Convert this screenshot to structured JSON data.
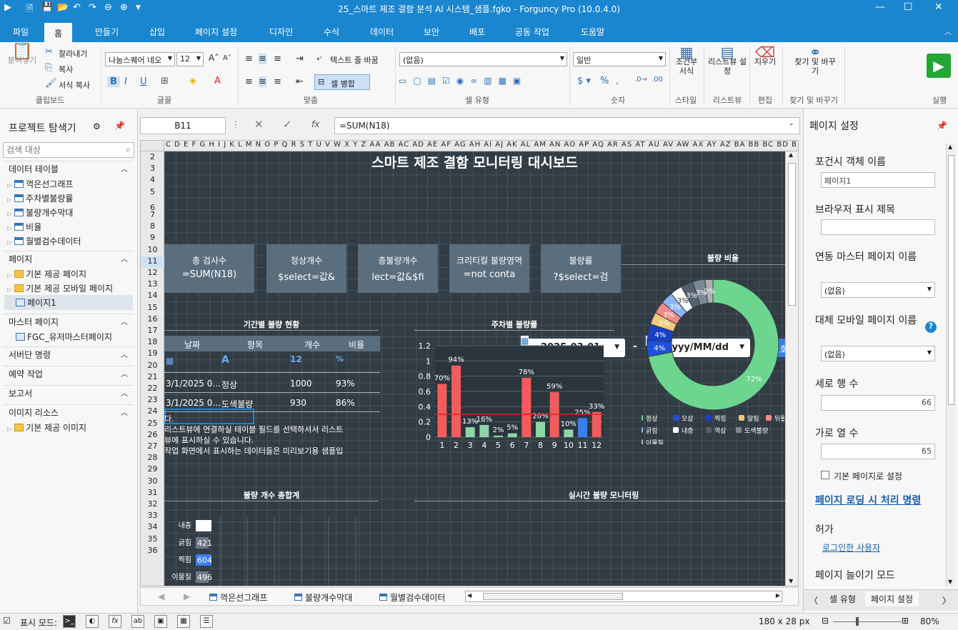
{
  "window": {
    "title": "25_스마트 제조 결함 분석 AI 시스템_샘플.fgko - Forguncy Pro (10.0.4.0)"
  },
  "menu": {
    "tabs": [
      "파일",
      "홈",
      "만들기",
      "삽입",
      "페이지 설정",
      "디자인",
      "수식",
      "데이터",
      "보안",
      "배포",
      "공동 작업",
      "도움말"
    ],
    "active": "홈"
  },
  "ribbon": {
    "paste": "붙여넣기",
    "cut": "잘라내기",
    "copy": "복사",
    "format_copy": "서식 복사",
    "clipboard_group": "클립보드",
    "font_name": "나눔스퀘어 네오",
    "font_size": "12",
    "font_group": "글꼴",
    "wrap": "텍스트 줄 바꿈",
    "merge": "셀 병합",
    "align_group": "맞춤",
    "cell_type_value": "(없음)",
    "cell_type_group": "셀 유형",
    "number_format": "일반",
    "number_group": "숫자",
    "cond_format": "조건부 서식",
    "style_group": "스타일",
    "listview": "리스트뷰 설정",
    "listview_group": "리스트뷰",
    "clear": "지우기",
    "edit_group": "편집",
    "find": "찾기 및 바꾸기",
    "find_group": "찾기 및 바꾸기",
    "run_group": "실행"
  },
  "explorer": {
    "title": "프로젝트 탐색기",
    "search_placeholder": "검색 대상",
    "sections": [
      {
        "name": "데이터 테이블",
        "items": [
          "꺽은선그래프",
          "주차별불량률",
          "불량개수막대",
          "비율",
          "월별검수데이터"
        ]
      },
      {
        "name": "페이지",
        "items": [
          "기본 제공 페이지",
          "기본 제공 모바일 페이지",
          "페이지1"
        ]
      },
      {
        "name": "마스터 페이지",
        "items": [
          "FGC_유저마스터페이지"
        ]
      },
      {
        "name": "서버단 명령",
        "items": []
      },
      {
        "name": "예약 작업",
        "items": []
      },
      {
        "name": "보고서",
        "items": []
      },
      {
        "name": "이미지 리소스",
        "items": [
          "기본 제공 이미지"
        ]
      }
    ]
  },
  "formula": {
    "cell_ref": "B11",
    "fx": "fx",
    "formula": "=SUM(N18)"
  },
  "sheet": {
    "columns": "C D E F G H I J K L M N O P Q R S T U V W X Y Z AA AB AC AD AE AF AG AH AI AJ AK AL AM AN AO AP AQ AR AS AT AU AV AW AX AY AZ BA BB BC BD BE BF BG BH BI",
    "rows": [
      "2",
      "3",
      "4",
      "5",
      "6",
      "7",
      "8",
      "9",
      "10",
      "11",
      "12",
      "13",
      "14",
      "15",
      "16",
      "17",
      "18",
      "19",
      "20",
      "21",
      "22",
      "23",
      "24",
      "25",
      "26",
      "27",
      "28",
      "29",
      "30",
      "31",
      "32",
      "33",
      "34",
      "35",
      "36"
    ]
  },
  "dashboard": {
    "title": "스마트 제조 결함 모니터링 대시보드",
    "date_from": "2025-03-01",
    "date_sep": "-",
    "date_to": "yyyy/MM/dd",
    "search_btn": "조회",
    "kpis": [
      {
        "label": "총 검사수",
        "value": "=SUM(N18)"
      },
      {
        "label": "정상개수",
        "value": "$select=값&"
      },
      {
        "label": "총불량개수",
        "value": "lect=값&$fi"
      },
      {
        "label": "크리티컬 불량영역",
        "value": "=not conta"
      },
      {
        "label": "불량률",
        "value": "?$select=검"
      }
    ],
    "ratio_title": "불량 비율",
    "period_title": "기간별 불량 현황",
    "table": {
      "headers": [
        "날짜",
        "항목",
        "개수",
        "비율"
      ],
      "rows": [
        [
          "3/1/2025 0...",
          "정상",
          "1000",
          "93%"
        ],
        [
          "3/1/2025 0...",
          "도색불량",
          "930",
          "86%"
        ]
      ],
      "note": [
        "다.",
        "리스트뷰에 연결하실 테이블 필드를 선택하셔서 리스트",
        "뷰에 표시하실 수 있습니다.",
        "작업 화면에서 표시하는 데이터들은 미리보기용 샘플입"
      ]
    },
    "weekly_title": "주차별 불량률",
    "total_title": "불량 개수 총합계",
    "realtime_title": "실시간 불량 모니터링",
    "hbar": [
      {
        "label": "내층",
        "value": ""
      },
      {
        "label": "긁힘",
        "value": "421"
      },
      {
        "label": "찍힘",
        "value": "604"
      },
      {
        "label": "이물질",
        "value": "496"
      }
    ]
  },
  "chart_data": [
    {
      "type": "bar",
      "title": "주차별 불량률",
      "categories": [
        "1",
        "2",
        "3",
        "4",
        "5",
        "6",
        "7",
        "8",
        "9",
        "10",
        "11",
        "12"
      ],
      "series": [
        {
          "values": [
            0.7,
            0.94,
            0.13,
            0.16,
            0.02,
            0.05,
            0.78,
            0.2,
            0.59,
            0.1,
            0.25,
            0.33
          ]
        }
      ],
      "data_labels": [
        "70%",
        "94%",
        "13%",
        "16%",
        "2%",
        "5%",
        "78%",
        "20%",
        "59%",
        "10%",
        "25%",
        "33%"
      ],
      "colors": [
        "#f25c5c",
        "#f25c5c",
        "#8ed6a8",
        "#8ed6a8",
        "#8ed6a8",
        "#8ed6a8",
        "#f25c5c",
        "#8ed6a8",
        "#f25c5c",
        "#8ed6a8",
        "#3a7ff0",
        "#f25c5c"
      ],
      "ylim": [
        0,
        1.2
      ],
      "yticks": [
        "0",
        "0.2",
        "0.4",
        "0.6",
        "0.8",
        "1",
        "1.2"
      ],
      "reference_line": 0.3
    },
    {
      "type": "pie",
      "title": "불량 비율",
      "labels": [
        "정상",
        "오삽",
        "찍힘",
        "말림",
        "뒤틀림",
        "긁힘",
        "내층",
        "역삽",
        "도색불량",
        "이물질"
      ],
      "values": [
        72,
        4,
        4,
        3,
        3,
        3,
        3,
        3,
        3,
        2
      ],
      "slice_labels": [
        "72%",
        "4%",
        "4%",
        "3%",
        "3%",
        "3%",
        "3%",
        "3%",
        "3%",
        "2%"
      ],
      "legend_labels": [
        "정상",
        "오삽",
        "찍힘",
        "말림",
        "뒤틀",
        "긁힘",
        "내층",
        "역삽",
        "도색불량",
        "이물질"
      ],
      "colors": [
        "#6cd68f",
        "#1f4fe0",
        "#1a3fc7",
        "#f2c879",
        "#f28a8a",
        "#8fb4f5",
        "#ffffff",
        "#546170",
        "#7c8a96",
        "#b0b0b0"
      ]
    }
  ],
  "rightpanel": {
    "title": "페이지 설정",
    "fields": [
      {
        "label": "포건시 객체 이름",
        "value": "페이지1"
      },
      {
        "label": "브라우저 표시 제목",
        "value": ""
      },
      {
        "label": "연동 마스터 페이지 이름",
        "value": "(없음)"
      },
      {
        "label": "대체 모바일 페이지 이름",
        "value": "(없음)"
      },
      {
        "label": "세로 행 수",
        "value": "66"
      },
      {
        "label": "가로 열 수",
        "value": "65"
      }
    ],
    "checkbox": "기본 페이지로 설정",
    "link": "페이지 로딩 시 처리 명령",
    "perm_label": "허가",
    "perm_value": "로그인한 사용자",
    "zoom_mode": "페이지 늘이기 모드",
    "tabs": [
      "셀 유형",
      "페이지 설정"
    ]
  },
  "sheettabs": [
    "꺽은선그래프",
    "불량개수막대",
    "월별검수데이터"
  ],
  "status": {
    "mode": "표시 모드:",
    "size": "180 x 28 px",
    "zoom": "80%"
  }
}
